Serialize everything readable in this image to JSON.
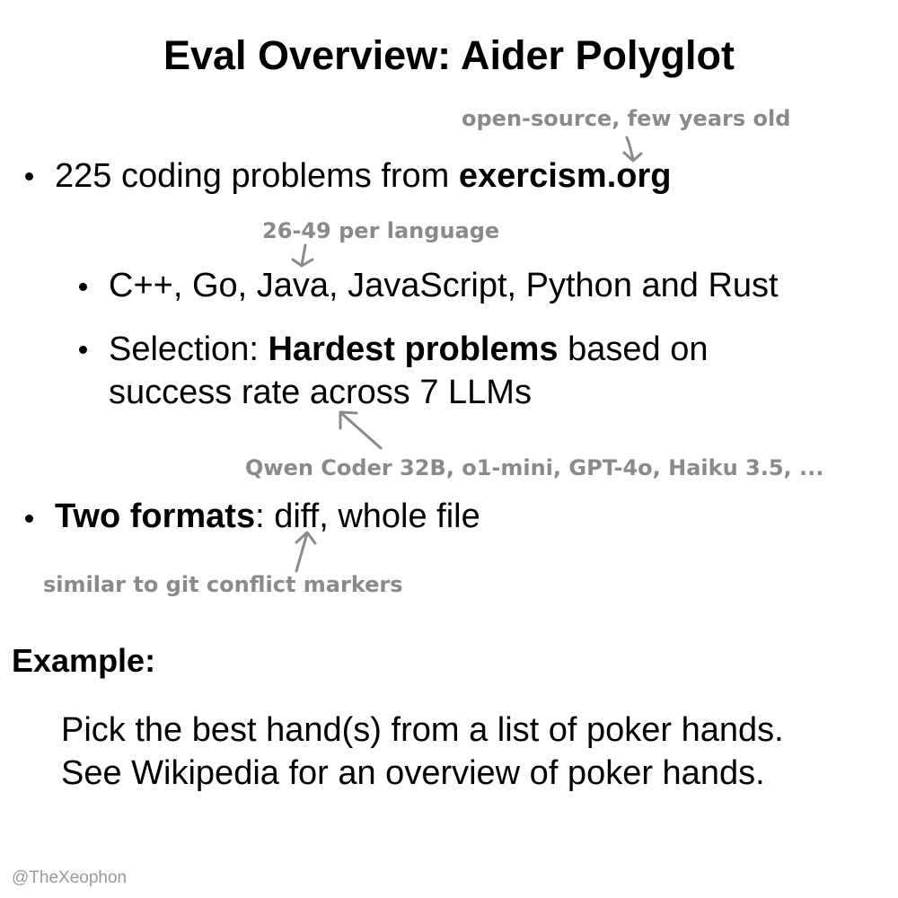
{
  "title": "Eval Overview: Aider Polyglot",
  "bullets": {
    "b1": {
      "prefix": "225 coding problems from ",
      "bold": "exercism.org",
      "note": "open-source, few years old"
    },
    "b1_1": {
      "text": "C++, Go, Java, JavaScript, Python and Rust",
      "note": "26-49 per language"
    },
    "b1_2": {
      "prefix": "Selection: ",
      "bold": "Hardest problems",
      "suffix": " based on",
      "line2": "success rate across 7 LLMs",
      "note": "Qwen Coder 32B, o1-mini, GPT-4o, Haiku 3.5, ..."
    },
    "b2": {
      "bold": "Two formats",
      "suffix": ": diff, whole file",
      "note": "similar to git conflict markers"
    }
  },
  "example": {
    "heading": "Example:",
    "line1": "Pick the best hand(s) from a list of poker hands.",
    "line2": "See Wikipedia for an overview of poker hands."
  },
  "footer": "@TheXeophon",
  "colors": {
    "text": "#000000",
    "annotation": "#8a8a8a",
    "footer": "#9a9a9a"
  }
}
